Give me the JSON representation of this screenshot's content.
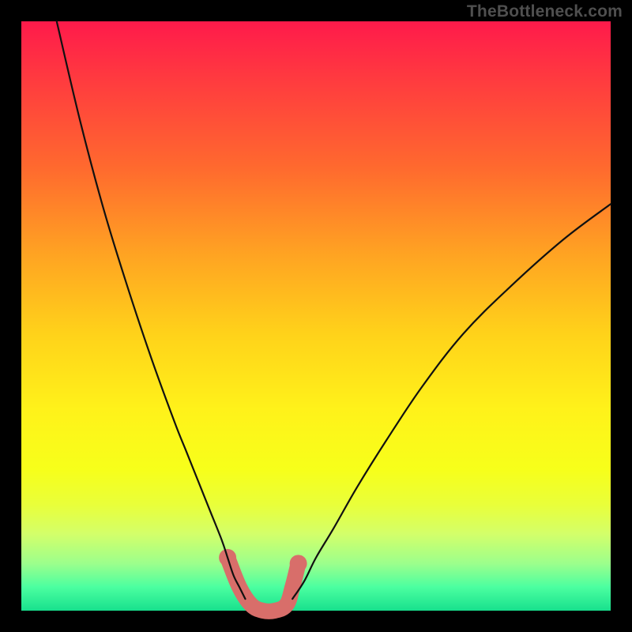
{
  "watermark": {
    "text": "TheBottleneck.com"
  },
  "chart_data": {
    "type": "line",
    "title": "",
    "xlabel": "",
    "ylabel": "",
    "xlim": [
      0,
      100
    ],
    "ylim": [
      0,
      100
    ],
    "grid": false,
    "legend": false,
    "series": [
      {
        "name": "left-curve",
        "x": [
          6,
          10,
          14,
          18,
          22,
          26,
          28,
          30,
          32,
          34,
          35,
          36,
          37,
          38
        ],
        "y": [
          100,
          83,
          68,
          55,
          43,
          32,
          27,
          22,
          17,
          12,
          9,
          6,
          4,
          2
        ]
      },
      {
        "name": "right-curve",
        "x": [
          46,
          48,
          50,
          53,
          57,
          62,
          68,
          75,
          83,
          92,
          100
        ],
        "y": [
          2,
          5,
          9,
          14,
          21,
          29,
          38,
          47,
          55,
          63,
          69
        ]
      },
      {
        "name": "valley-highlight",
        "x": [
          35,
          37,
          39,
          41,
          43,
          45,
          46,
          47
        ],
        "y": [
          9,
          4,
          1,
          0,
          0,
          1,
          4,
          8
        ]
      }
    ],
    "annotations": []
  }
}
